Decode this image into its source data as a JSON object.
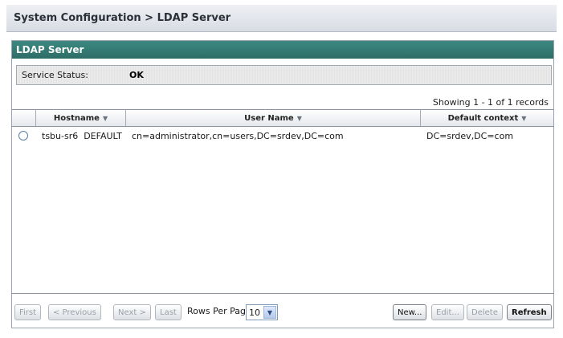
{
  "header": {
    "breadcrumb": "System Configuration > LDAP Server"
  },
  "panel": {
    "title": "LDAP Server",
    "service_status_label": "Service Status:",
    "service_status_value": "OK",
    "records_text": "Showing 1 - 1 of 1 records"
  },
  "table": {
    "columns": [
      "Hostname",
      "User Name",
      "Default context"
    ],
    "rows": [
      {
        "hostname": "tsbu-sr6  DEFAULT",
        "user_name": "cn=administrator,cn=users,DC=srdev,DC=com",
        "default_context": "DC=srdev,DC=com"
      }
    ]
  },
  "pagination": {
    "first": "First",
    "previous": "< Previous",
    "next": "Next >",
    "last": "Last",
    "rows_per_page_label": "Rows Per Page:",
    "rows_per_page_value": "10"
  },
  "actions": {
    "new": "New...",
    "edit": "Edit...",
    "delete": "Delete",
    "refresh": "Refresh"
  },
  "colors": {
    "panel_header": "#2d6c66",
    "title_bar": "#d8dce4"
  },
  "icons": {
    "sort_arrow": "sort-arrow-icon",
    "dropdown_arrow": "chevron-down-icon"
  }
}
